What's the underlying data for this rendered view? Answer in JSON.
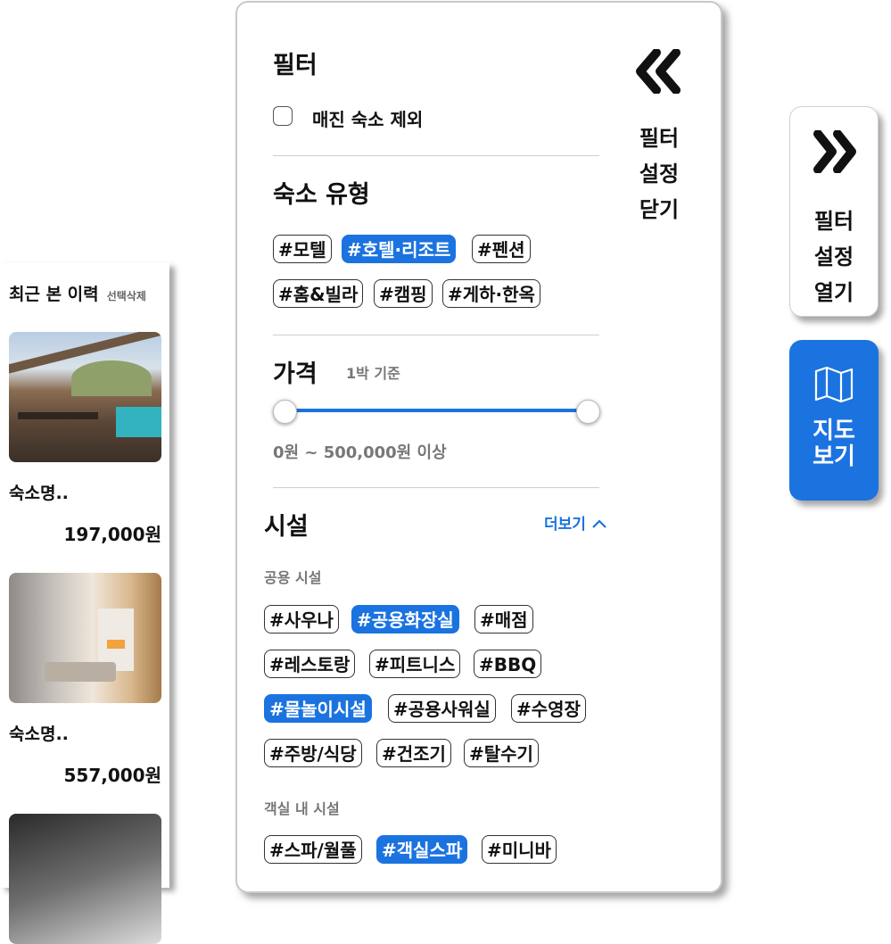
{
  "recent": {
    "title": "최근 본 이력",
    "delete_label": "선택삭제",
    "items": [
      {
        "name": "숙소명..",
        "price": "197,000원"
      },
      {
        "name": "숙소명..",
        "price": "557,000원"
      }
    ]
  },
  "filter": {
    "title": "필터",
    "exclude_soldout": "매진 숙소 제외",
    "close_lines": [
      "필터",
      "설정",
      "닫기"
    ],
    "lodging_title": "숙소 유형",
    "lodging_tags": [
      "#모텔",
      "#호텔·리조트",
      "#펜션",
      "#홈&빌라",
      "#캠핑",
      "#게하·한옥"
    ],
    "price_title": "가격",
    "price_sub": "1박 기준",
    "price_range_text": "0원 ~ 500,000원 이상",
    "price_range_fraction": [
      0,
      1
    ],
    "facility_title": "시설",
    "more_label": "더보기",
    "public_title": "공용 시설",
    "public_tags": [
      "#사우나",
      "#공용화장실",
      "#매점",
      "#레스토랑",
      "#피트니스",
      "#BBQ",
      "#물놀이시설",
      "#공용사워실",
      "#수영장",
      "#주방/식당",
      "#건조기",
      "#탈수기"
    ],
    "room_title": "객실 내 시설",
    "room_tags": [
      "#스파/월풀",
      "#객실스파",
      "#미니바"
    ],
    "selected": [
      "#호텔·리조트",
      "#공용화장실",
      "#물놀이시설",
      "#객실스파"
    ]
  },
  "open_button": {
    "lines": [
      "필터",
      "설정",
      "열기"
    ]
  },
  "map_button": {
    "lines": [
      "지도",
      "보기"
    ]
  },
  "colors": {
    "accent": "#1b73e0"
  }
}
